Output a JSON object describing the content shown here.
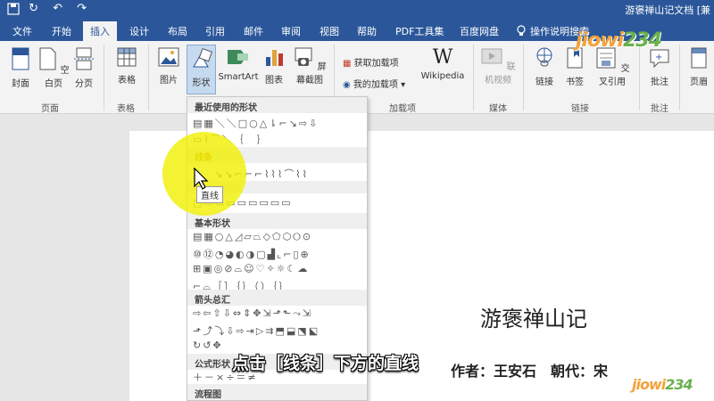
{
  "window": {
    "quick_access": "↻ ↶ ↷",
    "title": "游褒禅山记文档 [兼"
  },
  "tabs": [
    {
      "label": "文件"
    },
    {
      "label": "开始"
    },
    {
      "label": "插入"
    },
    {
      "label": "设计"
    },
    {
      "label": "布局"
    },
    {
      "label": "引用"
    },
    {
      "label": "邮件"
    },
    {
      "label": "审阅"
    },
    {
      "label": "视图"
    },
    {
      "label": "帮助"
    },
    {
      "label": "PDF工具集"
    },
    {
      "label": "百度网盘"
    },
    {
      "label": "操作说明搜索"
    }
  ],
  "ribbon": {
    "pages": {
      "cover": "封面",
      "blank": "空白页",
      "break": "分页",
      "group": "页面"
    },
    "table": {
      "label": "表格",
      "group": "表格"
    },
    "illustrations": {
      "picture": "图片",
      "shapes": "形状",
      "smartart": "SmartArt",
      "chart": "图表",
      "screenshot": "屏幕截图"
    },
    "addins": {
      "get": "获取加载项",
      "mine": "我的加载项",
      "wikipedia": "Wikipedia",
      "group": "加载项"
    },
    "media": {
      "online_video": "联机视频",
      "group": "媒体"
    },
    "links": {
      "link": "链接",
      "bookmark": "书签",
      "cross_ref": "交叉引用",
      "group": "链接"
    },
    "comments": {
      "comment": "批注",
      "group": "批注"
    },
    "header": {
      "label": "页眉"
    }
  },
  "shapes_dropdown": {
    "recent": "最近使用的形状",
    "lines": "线条",
    "rect": "",
    "basic": "基本形状",
    "arrows": "箭头总汇",
    "equation": "公式形状",
    "flowchart": "流程图",
    "tooltip": "直线"
  },
  "document": {
    "title": "游褒禅山记",
    "meta": "作者：王安石　朝代：宋"
  },
  "subtitle": "点击［线条］下方的直线",
  "watermark": {
    "text": "jiowi234"
  }
}
